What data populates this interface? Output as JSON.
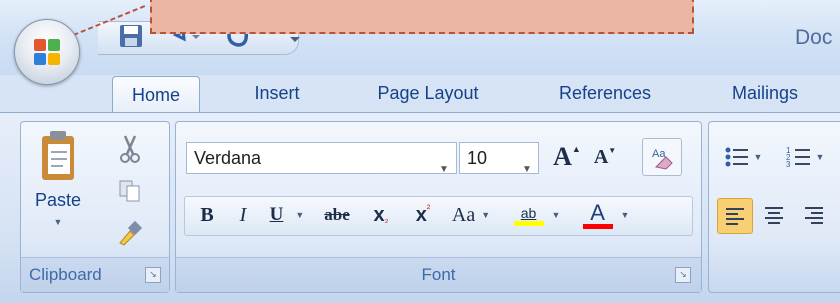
{
  "title_bar": {
    "document_title": "Doc",
    "quick_access": [
      {
        "name": "save",
        "icon": "save-icon"
      },
      {
        "name": "undo",
        "icon": "undo-icon"
      },
      {
        "name": "redo",
        "icon": "redo-icon"
      },
      {
        "name": "customize",
        "icon": "customize-qat-icon"
      }
    ],
    "office_button": {
      "icon": "office-logo-icon"
    }
  },
  "tabs": [
    "Home",
    "Insert",
    "Page Layout",
    "References",
    "Mailings"
  ],
  "active_tab": "Home",
  "clipboard": {
    "label": "Clipboard",
    "paste_label": "Paste",
    "buttons": [
      {
        "name": "cut",
        "icon": "scissors-icon"
      },
      {
        "name": "copy",
        "icon": "copy-icon"
      },
      {
        "name": "format-painter",
        "icon": "format-painter-icon"
      }
    ]
  },
  "font": {
    "label": "Font",
    "font_name": "Verdana",
    "font_size": "10",
    "grow_label": "A",
    "shrink_label": "A",
    "bold": "B",
    "italic": "I",
    "underline": "U",
    "strikethrough": "abe",
    "subscript": "x",
    "superscript": "x",
    "change_case": "Aa",
    "highlight": "ab",
    "font_color": "A",
    "highlight_color": "#ffff00",
    "font_color_value": "#ff0000"
  },
  "paragraph": {
    "buttons": [
      "bullets-icon",
      "numbering-icon",
      "align-left-icon",
      "center-icon",
      "align-right-icon"
    ]
  },
  "colors": {
    "callout_fill": "#eab5a3",
    "callout_border": "#b8523a",
    "accent_text": "#15428b"
  }
}
